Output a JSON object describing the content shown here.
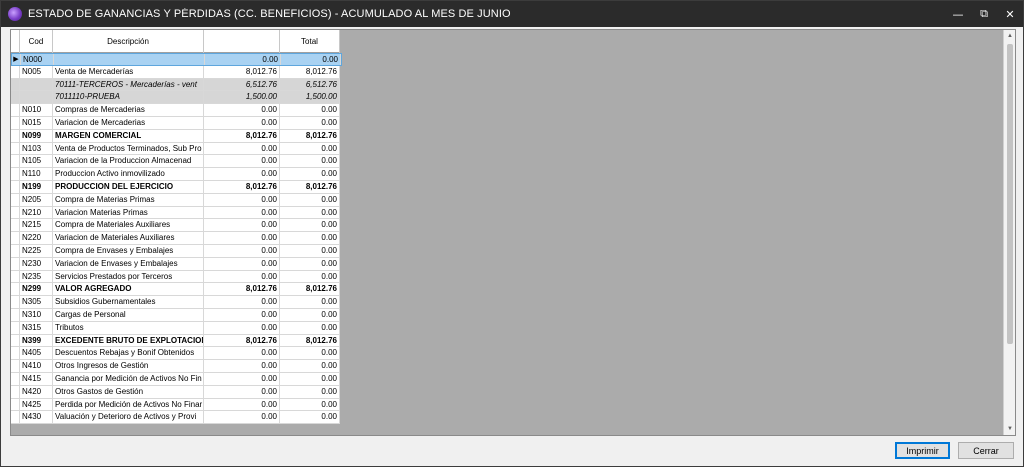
{
  "window": {
    "title": "ESTADO DE GANANCIAS Y PÉRDIDAS (CC. BENEFICIOS) - ACUMULADO AL MES DE JUNIO",
    "minimize_glyph": "—",
    "maximize_glyph": "⧉",
    "close_glyph": "✕"
  },
  "table": {
    "columns": [
      "Cod",
      "Descripción",
      "",
      "Total"
    ],
    "rows": [
      {
        "cod": "N000",
        "desc": "",
        "mes": "0.00",
        "total": "0.00",
        "style": "selected"
      },
      {
        "cod": "N005",
        "desc": "Venta de Mercaderías",
        "mes": "8,012.76",
        "total": "8,012.76",
        "style": "normal"
      },
      {
        "cod": "",
        "desc": "70111-TERCEROS - Mercaderías - vent",
        "mes": "6,512.76",
        "total": "6,512.76",
        "style": "sub"
      },
      {
        "cod": "",
        "desc": "7011110-PRUEBA",
        "mes": "1,500.00",
        "total": "1,500.00",
        "style": "sub"
      },
      {
        "cod": "N010",
        "desc": "Compras de Mercaderias",
        "mes": "0.00",
        "total": "0.00",
        "style": "normal"
      },
      {
        "cod": "N015",
        "desc": "Variacion de  Mercaderias",
        "mes": "0.00",
        "total": "0.00",
        "style": "normal"
      },
      {
        "cod": "N099",
        "desc": "MARGEN COMERCIAL",
        "mes": "8,012.76",
        "total": "8,012.76",
        "style": "bold"
      },
      {
        "cod": "N103",
        "desc": "Venta de Productos Terminados, Sub Pro",
        "mes": "0.00",
        "total": "0.00",
        "style": "normal"
      },
      {
        "cod": "N105",
        "desc": "Variacion de  la  Produccion  Almacenad",
        "mes": "0.00",
        "total": "0.00",
        "style": "normal"
      },
      {
        "cod": "N110",
        "desc": "Produccion Activo inmovilizado",
        "mes": "0.00",
        "total": "0.00",
        "style": "normal"
      },
      {
        "cod": "N199",
        "desc": "PRODUCCION DEL EJERCICIO",
        "mes": "8,012.76",
        "total": "8,012.76",
        "style": "bold"
      },
      {
        "cod": "N205",
        "desc": "Compra de Materias Primas",
        "mes": "0.00",
        "total": "0.00",
        "style": "normal"
      },
      {
        "cod": "N210",
        "desc": "Variacion Materias Primas",
        "mes": "0.00",
        "total": "0.00",
        "style": "normal"
      },
      {
        "cod": "N215",
        "desc": "Compra de  Materiales  Auxiliares",
        "mes": "0.00",
        "total": "0.00",
        "style": "normal"
      },
      {
        "cod": "N220",
        "desc": "Variacion de Materiales Auxiliares",
        "mes": "0.00",
        "total": "0.00",
        "style": "normal"
      },
      {
        "cod": "N225",
        "desc": "Compra de  Envases  y  Embalajes",
        "mes": "0.00",
        "total": "0.00",
        "style": "normal"
      },
      {
        "cod": "N230",
        "desc": "Variacion  de  Envases y  Embalajes",
        "mes": "0.00",
        "total": "0.00",
        "style": "normal"
      },
      {
        "cod": "N235",
        "desc": "Servicios  Prestados por  Terceros",
        "mes": "0.00",
        "total": "0.00",
        "style": "normal"
      },
      {
        "cod": "N299",
        "desc": "VALOR AGREGADO",
        "mes": "8,012.76",
        "total": "8,012.76",
        "style": "bold"
      },
      {
        "cod": "N305",
        "desc": "Subsidios  Gubernamentales",
        "mes": "0.00",
        "total": "0.00",
        "style": "normal"
      },
      {
        "cod": "N310",
        "desc": "Cargas  de  Personal",
        "mes": "0.00",
        "total": "0.00",
        "style": "normal"
      },
      {
        "cod": "N315",
        "desc": "Tributos",
        "mes": "0.00",
        "total": "0.00",
        "style": "normal"
      },
      {
        "cod": "N399",
        "desc": "EXCEDENTE BRUTO DE EXPLOTACION",
        "mes": "8,012.76",
        "total": "8,012.76",
        "style": "bold"
      },
      {
        "cod": "N405",
        "desc": "Descuentos Rebajas y Bonif Obtenidos",
        "mes": "0.00",
        "total": "0.00",
        "style": "normal"
      },
      {
        "cod": "N410",
        "desc": "Otros Ingresos de Gestión",
        "mes": "0.00",
        "total": "0.00",
        "style": "normal"
      },
      {
        "cod": "N415",
        "desc": "Ganancia por Medición de Activos No Fin",
        "mes": "0.00",
        "total": "0.00",
        "style": "normal"
      },
      {
        "cod": "N420",
        "desc": "Otros Gastos de Gestión",
        "mes": "0.00",
        "total": "0.00",
        "style": "normal"
      },
      {
        "cod": "N425",
        "desc": "Perdida por Medición de Activos No Finar",
        "mes": "0.00",
        "total": "0.00",
        "style": "normal"
      },
      {
        "cod": "N430",
        "desc": "Valuación y Deterioro de Activos y  Provi",
        "mes": "0.00",
        "total": "0.00",
        "style": "normal"
      }
    ]
  },
  "buttons": {
    "print_label": "Imprimir",
    "close_label": "Cerrar"
  }
}
